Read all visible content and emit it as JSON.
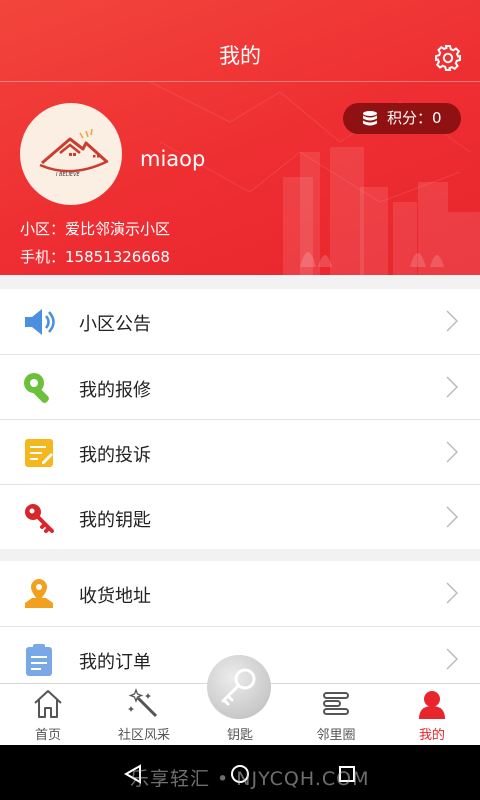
{
  "header": {
    "title": "我的",
    "settings_icon": "gear-icon"
  },
  "profile": {
    "avatar_caption": "I BELIEVE",
    "username": "miaop",
    "points_label": "积分：0",
    "community_label": "小区：爱比邻演示小区",
    "phone_label": "手机：15851326668"
  },
  "menu": {
    "group1": [
      {
        "label": "小区公告",
        "icon": "speaker-icon"
      },
      {
        "label": "我的报修",
        "icon": "wrench-icon"
      },
      {
        "label": "我的投诉",
        "icon": "notepad-icon"
      },
      {
        "label": "我的钥匙",
        "icon": "key-icon"
      }
    ],
    "group2": [
      {
        "label": "收货地址",
        "icon": "location-pin-icon"
      },
      {
        "label": "我的订单",
        "icon": "clipboard-icon"
      }
    ]
  },
  "tabbar": {
    "tabs": [
      {
        "label": "首页",
        "icon": "home-icon"
      },
      {
        "label": "社区风采",
        "icon": "magic-wand-icon"
      },
      {
        "label": "钥匙",
        "icon": "key-icon"
      },
      {
        "label": "邻里圈",
        "icon": "list-icon"
      },
      {
        "label": "我的",
        "icon": "person-icon"
      }
    ],
    "active_tab": "我的"
  },
  "watermark": "乐享轻汇 • NJYCQH.COM",
  "colors": {
    "brand_red": "#ee2e32",
    "points_badge": "#8f1111",
    "active_tab": "#e8252c",
    "speaker_blue": "#4a8fe0",
    "wrench_green": "#6cc03a",
    "notepad_yellow": "#f5b71e",
    "key_red": "#d9252b",
    "pin_orange": "#f2a11e",
    "clipboard_blue": "#78a8e6"
  }
}
